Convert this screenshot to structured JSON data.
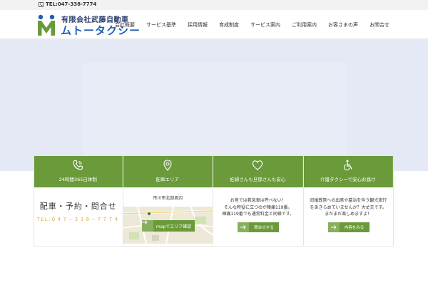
{
  "topbar": {
    "phone_icon": "phone-icon",
    "phone": "TEL:047-338-7774"
  },
  "logo": {
    "company": "有限会社武藤自動車",
    "brand": "ムトータクシー"
  },
  "nav": {
    "items": [
      {
        "label": "会社概要"
      },
      {
        "label": "サービス基準"
      },
      {
        "label": "採用情報"
      },
      {
        "label": "育成制度"
      },
      {
        "label": "サービス案内"
      },
      {
        "label": "ご利用案内"
      },
      {
        "label": "お客さまの声"
      },
      {
        "label": "お問合せ"
      }
    ]
  },
  "cards": {
    "reservation": {
      "icon": "phone-icon",
      "label": "24時間365日体制",
      "big": "配車・予約・問合せ",
      "tel": "TEL:０４７－３３８－７７７４"
    },
    "area": {
      "icon": "map-pin-icon",
      "label": "配車エリア",
      "caption": "市川市北部周辺",
      "map_button": "mapでエリア確認"
    },
    "pregnant": {
      "icon": "heart-icon",
      "label": "妊婦さんも旦那さんも安心",
      "text1": "お産では救急車は呼べない！",
      "text2": "そんな時役に立つのが陣痛119番。",
      "text3": "陣痛119番でも通常料金と同様です。",
      "button": "問合せする"
    },
    "care": {
      "icon": "wheelchair-icon",
      "label": "介護タクシーで安心お届け",
      "text1": "冠婚葬祭への出席や墓治を伴う観光旅行",
      "text2": "をあきらめていませんか？大丈夫です。",
      "text3": "まだまだ楽しめますよ！",
      "button": "内容をみる"
    }
  },
  "colors": {
    "green": "#6a9a3a",
    "hero": "#e4e9f5",
    "navy": "#2e3f6e",
    "blue": "#1d5fb0",
    "orange": "#e0a02a"
  }
}
